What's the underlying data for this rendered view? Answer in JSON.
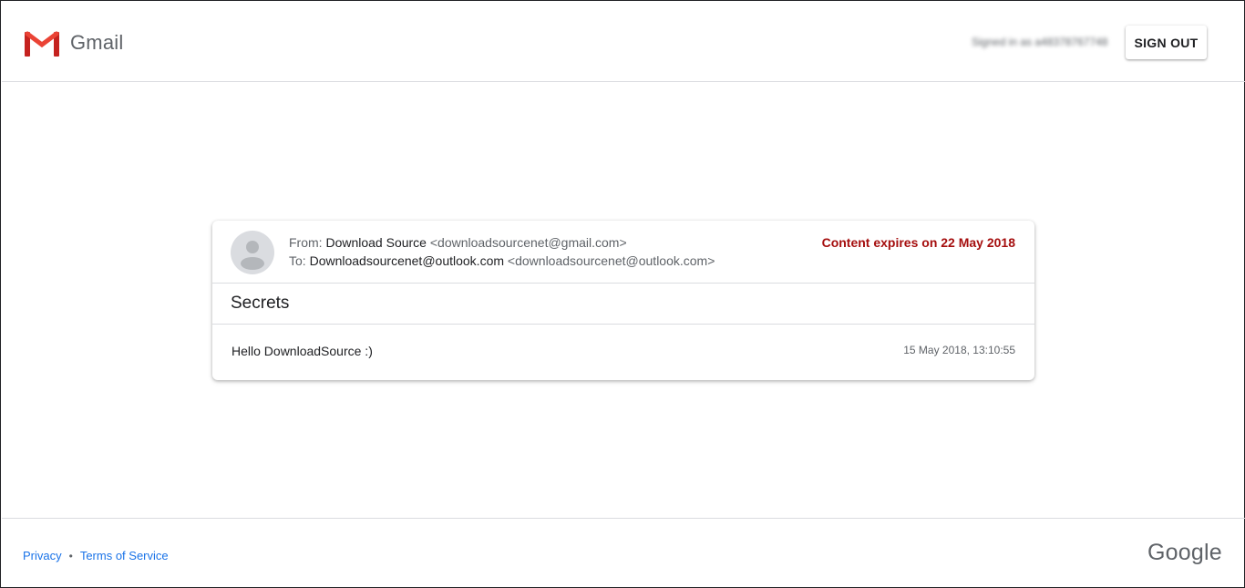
{
  "header": {
    "app_name": "Gmail",
    "signed_in_text": "Signed in as a48378767748",
    "sign_out_label": "SIGN OUT"
  },
  "message": {
    "from_label": "From:",
    "from_name": "Download Source",
    "from_email": "<downloadsourcenet@gmail.com>",
    "to_label": "To:",
    "to_name": "Downloadsourcenet@outlook.com",
    "to_email": "<downloadsourcenet@outlook.com>",
    "expiry": "Content expires on 22 May 2018",
    "subject": "Secrets",
    "body": "Hello DownloadSource :)",
    "timestamp": "15 May 2018, 13:10:55"
  },
  "footer": {
    "privacy": "Privacy",
    "separator": "•",
    "terms": "Terms of Service",
    "brand": "Google"
  },
  "colors": {
    "accent_blue": "#1a73e8",
    "expiry_red": "#a50e0e",
    "gmail_red": "#d93025"
  }
}
